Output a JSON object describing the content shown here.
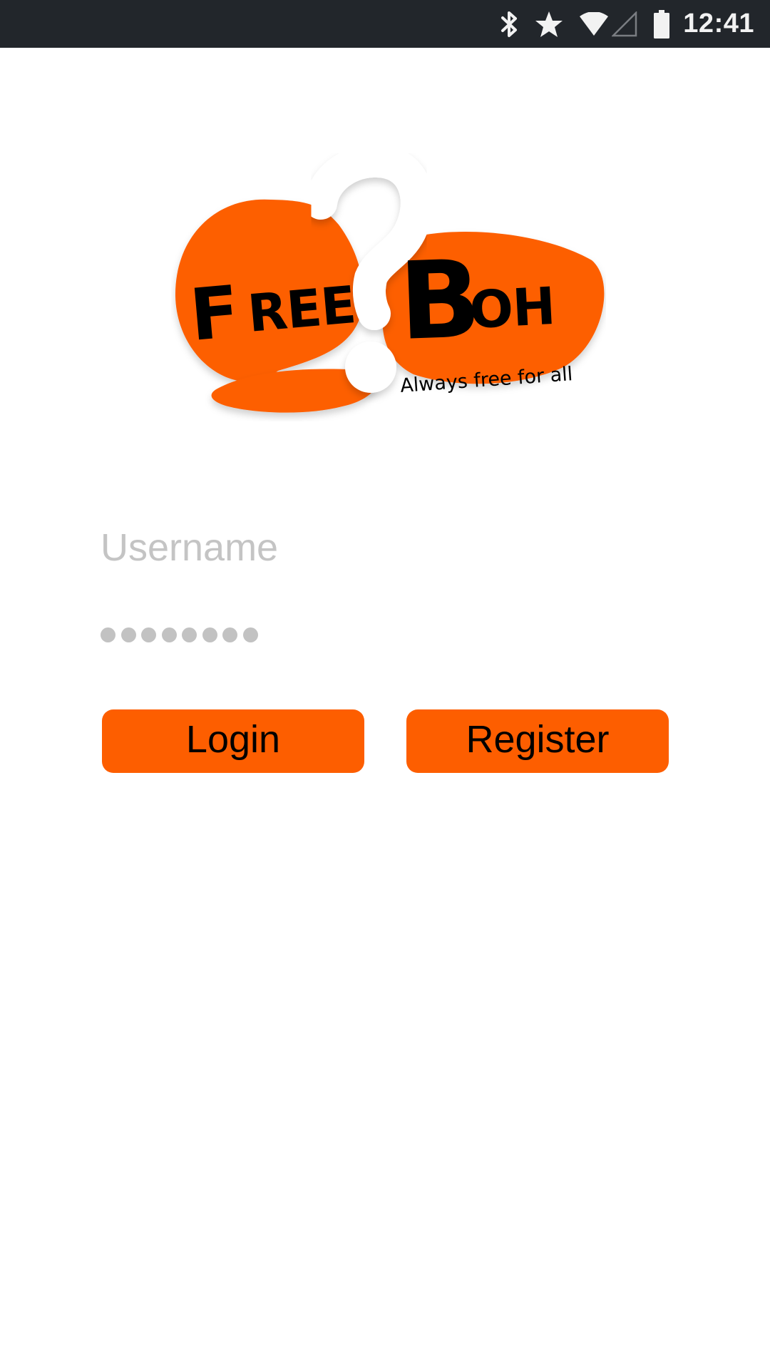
{
  "status_bar": {
    "time": "12:41",
    "icons": [
      "bluetooth-icon",
      "star-icon",
      "wifi-icon",
      "cell-signal-icon",
      "battery-icon"
    ]
  },
  "logo": {
    "wordmark": "FreeBoh",
    "tagline": "Always free for all",
    "brand_color": "#fd5e00"
  },
  "form": {
    "username_placeholder": "Username",
    "username_value": "",
    "password_masked_length": 8
  },
  "buttons": {
    "login_label": "Login",
    "register_label": "Register"
  },
  "colors": {
    "accent": "#fd5e00",
    "status_bar_bg": "#22262b",
    "placeholder": "#c4c4c4"
  }
}
